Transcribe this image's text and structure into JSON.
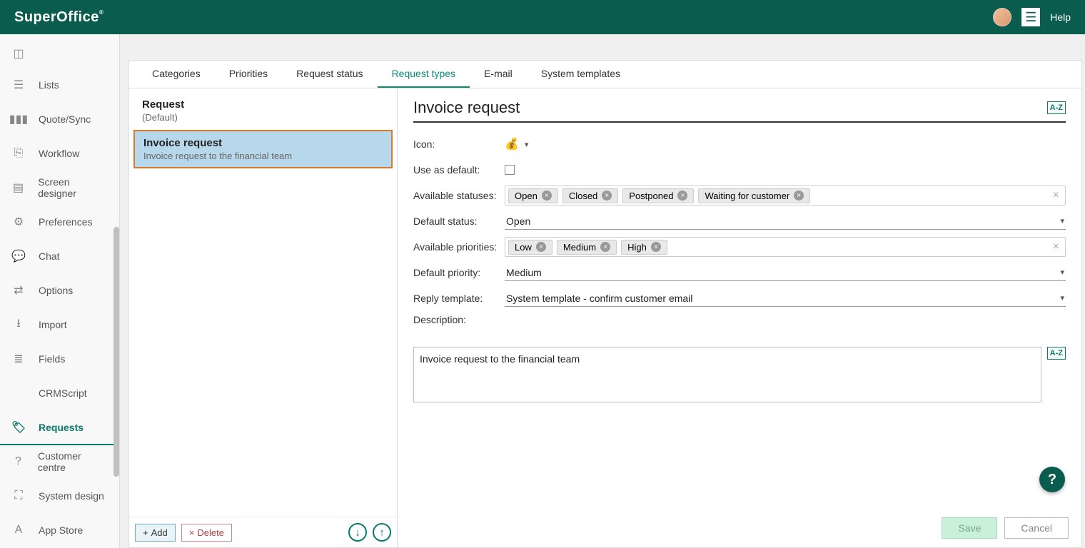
{
  "header": {
    "brand": "SuperOffice",
    "help": "Help"
  },
  "sidebar": {
    "items": [
      {
        "name": "lists",
        "label": "Lists",
        "icon": "☰"
      },
      {
        "name": "quote-sync",
        "label": "Quote/Sync",
        "icon": "▮▮▮"
      },
      {
        "name": "workflow",
        "label": "Workflow",
        "icon": "⎘"
      },
      {
        "name": "screen-designer",
        "label": "Screen designer",
        "icon": "▤"
      },
      {
        "name": "preferences",
        "label": "Preferences",
        "icon": "⚙"
      },
      {
        "name": "chat",
        "label": "Chat",
        "icon": "💬"
      },
      {
        "name": "options",
        "label": "Options",
        "icon": "⇄"
      },
      {
        "name": "import",
        "label": "Import",
        "icon": "⭳"
      },
      {
        "name": "fields",
        "label": "Fields",
        "icon": "≣"
      },
      {
        "name": "crmscript",
        "label": "CRMScript",
        "icon": "</>"
      },
      {
        "name": "requests",
        "label": "Requests",
        "icon": "🏷"
      },
      {
        "name": "customer-centre",
        "label": "Customer centre",
        "icon": "?"
      },
      {
        "name": "system-design",
        "label": "System design",
        "icon": "⛶"
      },
      {
        "name": "app-store",
        "label": "App Store",
        "icon": "A"
      }
    ],
    "activeIndex": 10
  },
  "tabs": {
    "items": [
      "Categories",
      "Priorities",
      "Request status",
      "Request types",
      "E-mail",
      "System templates"
    ],
    "activeIndex": 3
  },
  "list": {
    "items": [
      {
        "title": "Request",
        "sub": "(Default)"
      },
      {
        "title": "Invoice request",
        "sub": "Invoice request to the financial team"
      }
    ],
    "selectedIndex": 1,
    "add": "Add",
    "delete": "Delete"
  },
  "form": {
    "title": "Invoice request",
    "az": "A-Z",
    "labels": {
      "icon": "Icon:",
      "use_default": "Use as default:",
      "avail_statuses": "Available statuses:",
      "default_status": "Default status:",
      "avail_priorities": "Available priorities:",
      "default_priority": "Default priority:",
      "reply_template": "Reply template:",
      "description": "Description:"
    },
    "values": {
      "icon_glyph": "💰",
      "use_default": false,
      "statuses": [
        "Open",
        "Closed",
        "Postponed",
        "Waiting for customer"
      ],
      "default_status": "Open",
      "priorities": [
        "Low",
        "Medium",
        "High"
      ],
      "default_priority": "Medium",
      "reply_template": "System template - confirm customer email",
      "description": "Invoice request to the financial team"
    },
    "buttons": {
      "save": "Save",
      "cancel": "Cancel"
    }
  }
}
